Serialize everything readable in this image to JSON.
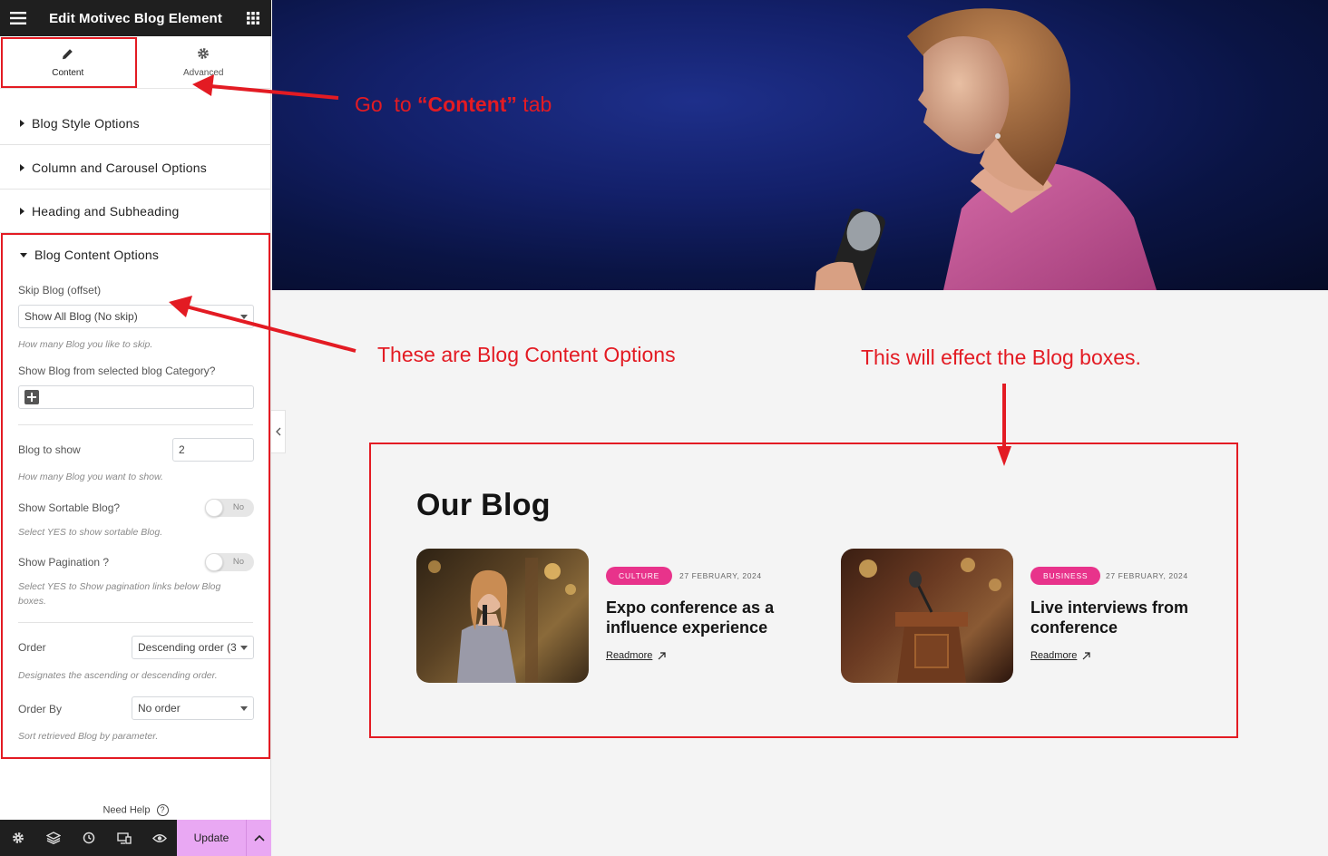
{
  "editor": {
    "title": "Edit Motivec Blog Element",
    "tabs": [
      {
        "label": "Content",
        "icon": "pencil-icon"
      },
      {
        "label": "Advanced",
        "icon": "gear-icon"
      }
    ],
    "sections": [
      {
        "label": "Blog Style Options",
        "open": false
      },
      {
        "label": "Column and Carousel Options",
        "open": false
      },
      {
        "label": "Heading and Subheading",
        "open": false
      },
      {
        "label": "Blog Content Options",
        "open": true
      }
    ],
    "fields": {
      "skip": {
        "label": "Skip Blog (offset)",
        "value": "Show All Blog (No skip)",
        "hint": "How many Blog you like to skip."
      },
      "category": {
        "label": "Show Blog from selected blog Category?"
      },
      "blog_to_show": {
        "label": "Blog to show",
        "value": "2",
        "hint": "How many Blog you want to show."
      },
      "sortable": {
        "label": "Show Sortable Blog?",
        "toggle": "No",
        "hint": "Select YES to show sortable Blog."
      },
      "pagination": {
        "label": "Show Pagination ?",
        "toggle": "No",
        "hint": "Select YES to Show pagination links below Blog boxes."
      },
      "order": {
        "label": "Order",
        "value": "Descending order (3",
        "hint": "Designates the ascending or descending order."
      },
      "order_by": {
        "label": "Order By",
        "value": "No order",
        "hint": "Sort retrieved Blog by parameter."
      }
    },
    "need_help": "Need Help",
    "update_label": "Update"
  },
  "preview": {
    "blog_heading": "Our Blog",
    "posts": [
      {
        "category": "CULTURE",
        "date": "27 FEBRUARY, 2024",
        "title": "Expo conference as a influence experience",
        "readmore": "Readmore"
      },
      {
        "category": "BUSINESS",
        "date": "27 FEBRUARY, 2024",
        "title": "Live interviews from conference",
        "readmore": "Readmore"
      }
    ]
  },
  "annotations": {
    "content_tab_prefix": "Go  to ",
    "content_tab_bold": "“Content”",
    "content_tab_suffix": " tab",
    "options": "These are Blog Content Options",
    "effect": "This will effect the Blog boxes."
  },
  "colors": {
    "accent": "#e8338b",
    "annotation": "#e31b23",
    "update": "#e9a8f3"
  }
}
